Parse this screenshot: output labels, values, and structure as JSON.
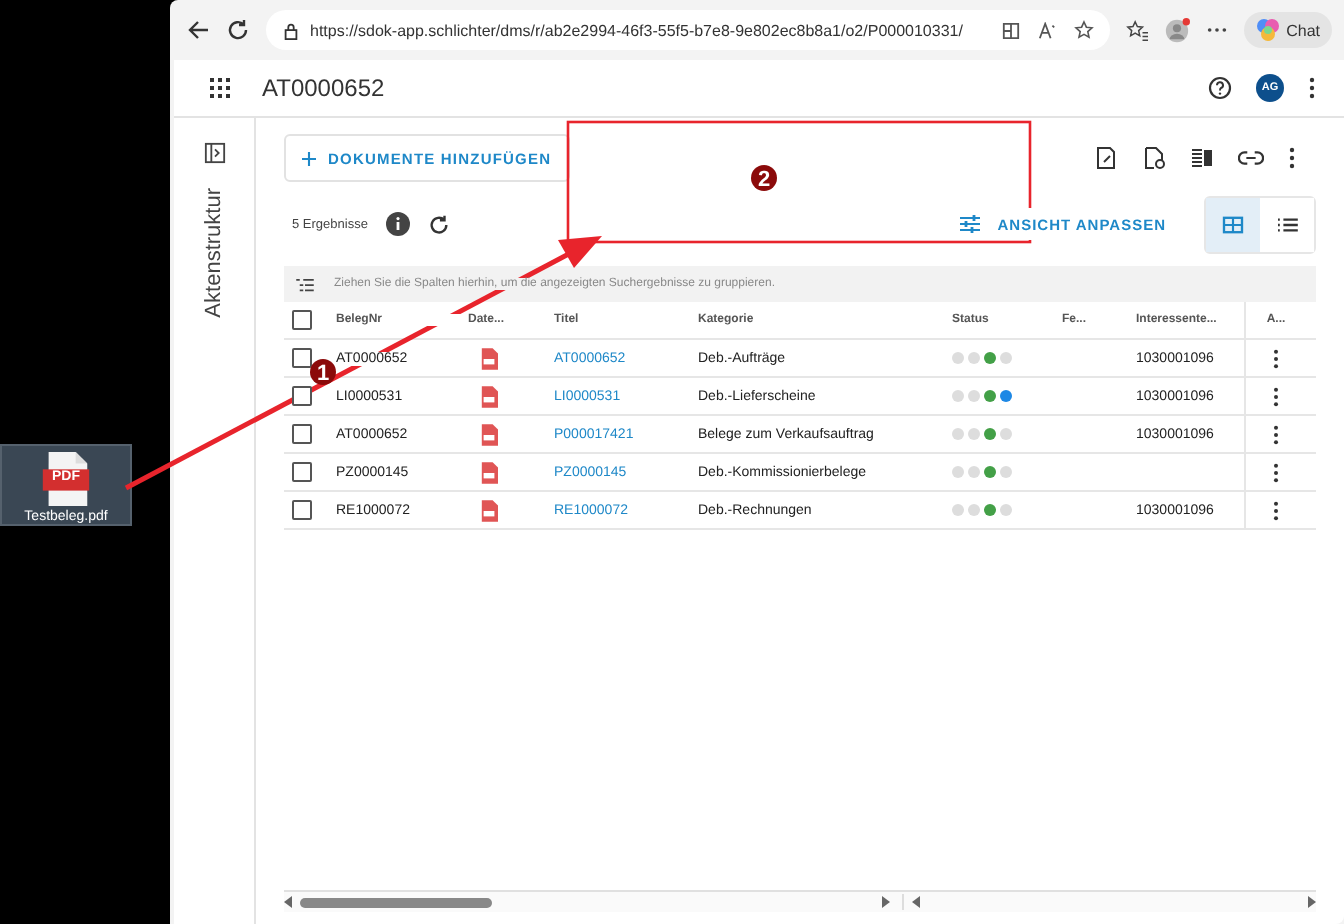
{
  "browser": {
    "url": "https://sdok-app.schlichter/dms/r/ab2e2994-46f3-55f5-b7e8-9e802ec8b8a1/o2/P000010331/",
    "chat_label": "Chat"
  },
  "desktop_file": {
    "name": "Testbeleg.pdf",
    "badge": "PDF"
  },
  "header": {
    "title": "AT0000652",
    "avatar": "AG"
  },
  "sidebar": {
    "title": "Aktenstruktur"
  },
  "toolbar": {
    "add_button": "DOKUMENTE HINZUFÜGEN",
    "result_count": "5 Ergebnisse",
    "customize_button": "ANSICHT ANPASSEN",
    "views": [
      {
        "kind": "table",
        "selected": true
      },
      {
        "kind": "list",
        "selected": false
      }
    ]
  },
  "table": {
    "group_hint": "Ziehen Sie die Spalten hierhin, um die angezeigten Suchergebnisse zu gruppieren.",
    "all_checked": false,
    "columns": [
      "BelegNr",
      "Date...",
      "Titel",
      "Kategorie",
      "Status",
      "Fe...",
      "Interessente...",
      "A..."
    ],
    "rows": [
      {
        "checked": false,
        "number": "AT0000652",
        "title": "AT0000652",
        "category": "Deb.-Aufträge",
        "status": [
          {
            "color": "#dddddd"
          },
          {
            "color": "#dddddd"
          },
          {
            "color": "#43a047"
          },
          {
            "color": "#dddddd"
          }
        ],
        "party": "1030001096"
      },
      {
        "checked": false,
        "number": "LI0000531",
        "title": "LI0000531",
        "category": "Deb.-Lieferscheine",
        "status": [
          {
            "color": "#dddddd"
          },
          {
            "color": "#dddddd"
          },
          {
            "color": "#43a047"
          },
          {
            "color": "#1e88e5"
          }
        ],
        "party": "1030001096"
      },
      {
        "checked": false,
        "number": "AT0000652",
        "title": "P000017421",
        "category": "Belege zum Verkaufsauftrag",
        "status": [
          {
            "color": "#dddddd"
          },
          {
            "color": "#dddddd"
          },
          {
            "color": "#43a047"
          },
          {
            "color": "#dddddd"
          }
        ],
        "party": "1030001096"
      },
      {
        "checked": false,
        "number": "PZ0000145",
        "title": "PZ0000145",
        "category": "Deb.-Kommissionierbelege",
        "status": [
          {
            "color": "#dddddd"
          },
          {
            "color": "#dddddd"
          },
          {
            "color": "#43a047"
          },
          {
            "color": "#dddddd"
          }
        ]
      },
      {
        "checked": false,
        "number": "RE1000072",
        "title": "RE1000072",
        "category": "Deb.-Rechnungen",
        "status": [
          {
            "color": "#dddddd"
          },
          {
            "color": "#dddddd"
          },
          {
            "color": "#43a047"
          },
          {
            "color": "#dddddd"
          }
        ],
        "party": "1030001096"
      }
    ]
  },
  "callouts": [
    {
      "number": "1"
    },
    {
      "number": "2"
    }
  ]
}
